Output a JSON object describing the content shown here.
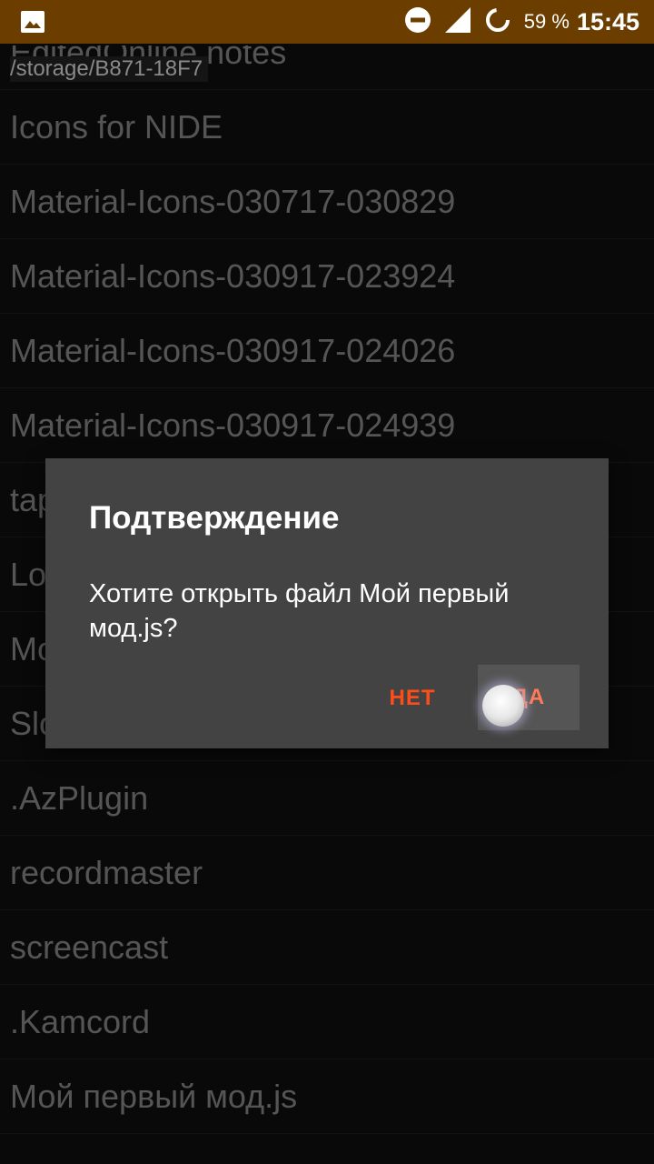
{
  "statusbar": {
    "battery_percent": "59 %",
    "time": "15:45",
    "icons": [
      "image-notification-icon",
      "do-not-disturb-icon",
      "signal-icon",
      "battery-saver-icon"
    ]
  },
  "path": "/storage/B871-18F7",
  "files": [
    "EditedOnline notes",
    "Icons for NIDE",
    "Material-Icons-030717-030829",
    "Material-Icons-030917-023924",
    "Material-Icons-030917-024026",
    "Material-Icons-030917-024939",
    "tap",
    "Lo",
    "Mo",
    "SlotRacing",
    ".AzPlugin",
    "recordmaster",
    "screencast",
    ".Kamcord",
    "Мой первый мод.js"
  ],
  "dialog": {
    "title": "Подтверждение",
    "message": "Хотите открыть файл Мой первый мод.js?",
    "no_label": "НЕТ",
    "yes_label": "ДА"
  },
  "colors": {
    "statusbar": "#6b3e00",
    "background": "#151515",
    "dialog": "#434343",
    "accent": "#ff4d1a"
  }
}
